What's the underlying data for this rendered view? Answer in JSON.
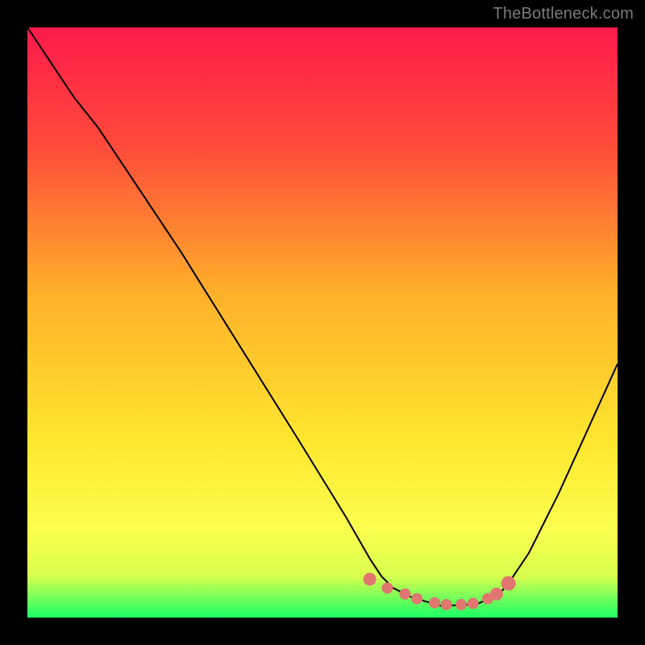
{
  "watermark": "TheBottleneck.com",
  "chart_data": {
    "type": "line",
    "title": "",
    "xlabel": "",
    "ylabel": "",
    "xlim": [
      0,
      1
    ],
    "ylim": [
      0,
      1
    ],
    "gradient_stops": [
      {
        "offset": 0.0,
        "color": "#ff1a4b"
      },
      {
        "offset": 0.2,
        "color": "#ff4a3a"
      },
      {
        "offset": 0.45,
        "color": "#ffb02a"
      },
      {
        "offset": 0.7,
        "color": "#ffe62f"
      },
      {
        "offset": 0.85,
        "color": "#fbff4e"
      },
      {
        "offset": 0.93,
        "color": "#d8ff4e"
      },
      {
        "offset": 1.0,
        "color": "#19ff66"
      }
    ],
    "series": [
      {
        "name": "curve",
        "x": [
          0.0,
          0.03,
          0.06,
          0.08,
          0.12,
          0.18,
          0.26,
          0.36,
          0.46,
          0.54,
          0.58,
          0.6,
          0.62,
          0.65,
          0.7,
          0.76,
          0.8,
          0.82,
          0.85,
          0.9,
          0.95,
          1.0
        ],
        "y": [
          1.0,
          0.955,
          0.91,
          0.88,
          0.83,
          0.74,
          0.62,
          0.46,
          0.3,
          0.17,
          0.1,
          0.07,
          0.05,
          0.035,
          0.02,
          0.022,
          0.04,
          0.065,
          0.11,
          0.21,
          0.32,
          0.43
        ]
      },
      {
        "name": "dots",
        "x": [
          0.58,
          0.61,
          0.64,
          0.66,
          0.69,
          0.71,
          0.735,
          0.755,
          0.78,
          0.795,
          0.815
        ],
        "y": [
          0.065,
          0.05,
          0.04,
          0.032,
          0.025,
          0.022,
          0.022,
          0.024,
          0.032,
          0.04,
          0.058
        ],
        "sizes": [
          8,
          7,
          7,
          7,
          7,
          7,
          7,
          7,
          7,
          8,
          9
        ]
      }
    ],
    "dot_color": "#e0766f",
    "curve_color": "#000000"
  }
}
